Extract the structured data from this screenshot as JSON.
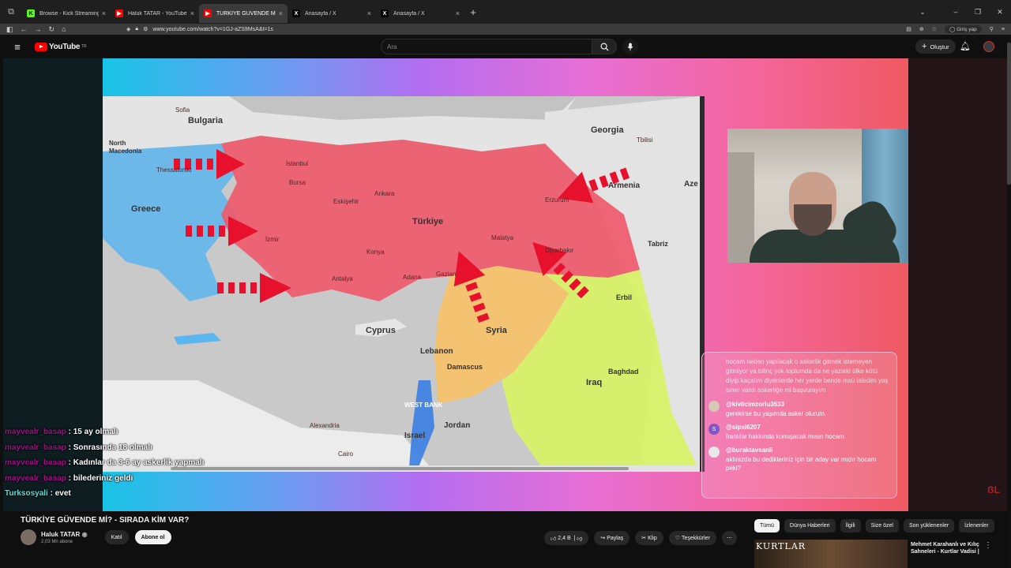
{
  "tabs": [
    {
      "label": "Browse - Kick Streaming",
      "fav": "K",
      "fav_color": "#53fc18"
    },
    {
      "label": "Haluk TATAR - YouTube",
      "fav": "▶",
      "fav_color": "#ff0000"
    },
    {
      "label": "TÜRKİYE GÜVENDE Mİ? - S",
      "fav": "▶",
      "fav_color": "#ff0000",
      "active": true
    },
    {
      "label": "Anasayfa / X",
      "fav": "X",
      "fav_color": "#000000"
    },
    {
      "label": "Anasayfa / X",
      "fav": "X",
      "fav_color": "#000000"
    }
  ],
  "address": {
    "url": "www.youtube.com/watch?v=1GJ-aZS9MsA&t=1s",
    "login": "Giriş yap"
  },
  "youtube": {
    "logo_text": "YouTube",
    "logo_region": "TR",
    "search_placeholder": "Ara",
    "create_label": "Oluştur"
  },
  "map": {
    "labels": {
      "bulgaria": "Bulgaria",
      "north_macedonia": "North\nMacedonia",
      "greece": "Greece",
      "turkiye": "Türkiye",
      "georgia": "Georgia",
      "armenia": "Armenia",
      "aze": "Aze",
      "syria": "Syria",
      "iraq": "Iraq",
      "cyprus": "Cyprus",
      "lebanon": "Lebanon",
      "jordan": "Jordan",
      "israel": "Israel",
      "west_bank": "WEST BANK",
      "damascus": "Damascus",
      "baghdad": "Baghdad",
      "erbil": "Erbil",
      "tabriz": "Tabriz",
      "ankara": "Ankara",
      "istanbul": "İstanbul",
      "bursa": "Bursa",
      "eskisehir": "Eskişehir",
      "izmir": "İzmir",
      "konya": "Konya",
      "antalya": "Antalya",
      "adana": "Adana",
      "gaziantep": "Gazian",
      "cairo": "Cairo",
      "alexandria": "Alexandria",
      "thessaloniki": "Thessaloniki",
      "sofia": "Sofia",
      "tbilisi": "Tbilisi",
      "erzurum": "Erzurum",
      "malatya": "Malatya",
      "diyarbakir": "Diyarbakır"
    }
  },
  "side_chat": {
    "faded": "hocam neden yapılacak o askerlik gitmek istemeyen gitmiyor ya bilinç yok toplumda da ne yazıkki ülke kötü diyip kaçalım diyenlerde her yerde bende msü istedim yaş sınırı vardı askerliğe mi başvurayım",
    "messages": [
      {
        "user": "@kivilcimzorlu3533",
        "text": "gerekirse bu yaşımda asker olurum.",
        "avatar": "",
        "avatar_color": "#d7c9b8"
      },
      {
        "user": "@sipsi6207",
        "text": "İranlılar hakkında konuşacak mısın hocam",
        "avatar": "S",
        "avatar_color": "#7e57c2"
      },
      {
        "user": "@buraktavsanli",
        "text": "aklınızda bu dedikleriniz için bir aday var mıdır hocam peki?",
        "avatar": "",
        "avatar_color": "#e8e8e8"
      }
    ]
  },
  "overlay_chat": [
    {
      "user": "mayvealr_basap",
      "text": ": 15 ay olmalı"
    },
    {
      "user": "mayvealr_basap",
      "text": ": Sonrasında 18 olmalı"
    },
    {
      "user": "mayvealr_basap",
      "text": ": Kadınlar da 3-6 ay askerlik yapmalı"
    },
    {
      "user": "mayvealr_basap",
      "text": ": bilederiniz geldi"
    },
    {
      "user": "Turksosyali",
      "text": ": evet"
    }
  ],
  "video": {
    "title": "TÜRKİYE GÜVENDE Mİ? - SIRADA KİM VAR?",
    "channel": "Haluk TATAR",
    "subs": "2,03 Mn abone",
    "join_label": "Katıl",
    "subscribe_label": "Abone ol",
    "likes": "2,4 B",
    "share_label": "Paylaş",
    "clip_label": "Klip",
    "thanks_label": "Teşekkürler"
  },
  "chips": [
    "Tümü",
    "Dünya Haberleri",
    "İlgili",
    "Size özel",
    "Son yüklenenler",
    "İzlenenler"
  ],
  "recommendation": {
    "thumb_text": "KURTLAR",
    "title": "Mehmet Karahanlı ve Kılıç Sahneleri - Kurtlar Vadisi |"
  }
}
